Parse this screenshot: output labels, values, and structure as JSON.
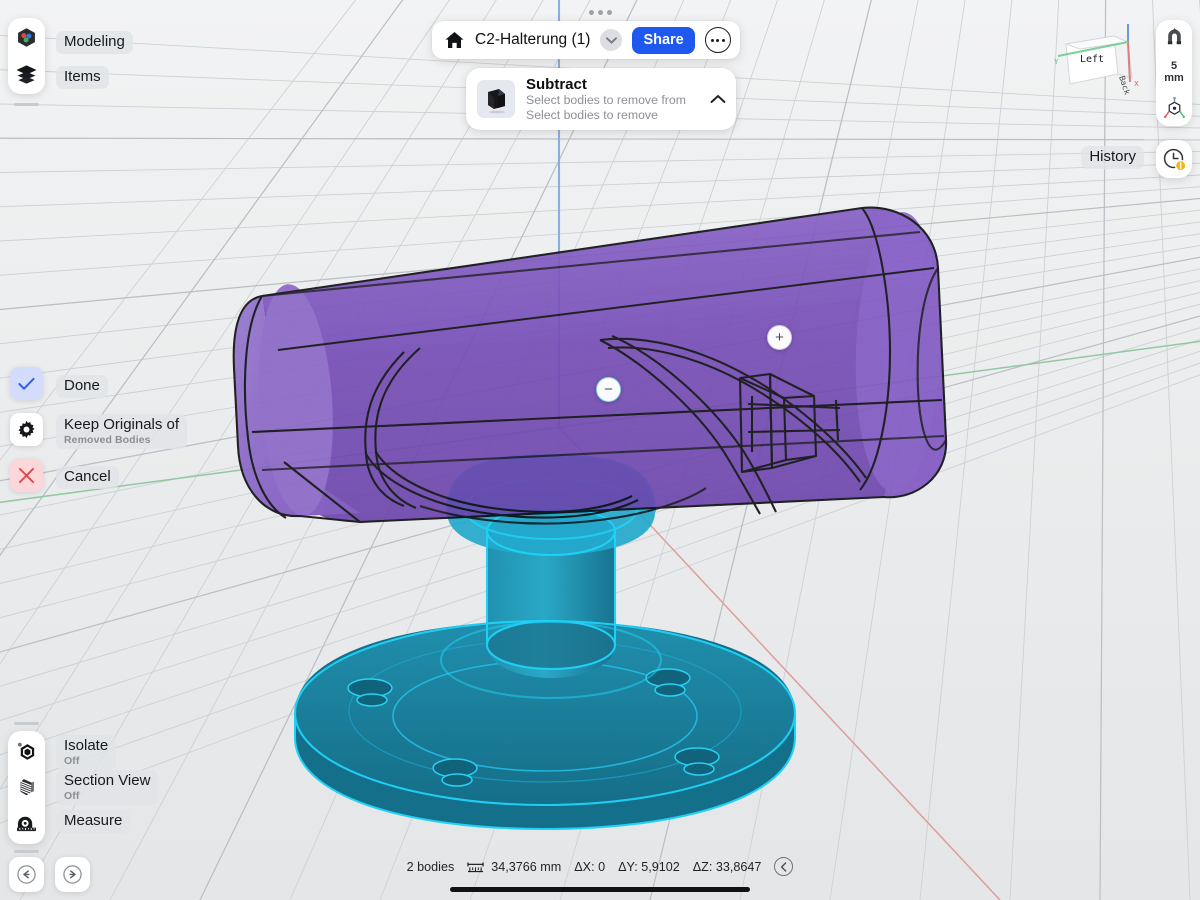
{
  "app": {
    "background_color": "#edeff1",
    "accent_blue": "#1f58ef"
  },
  "titlebar": {
    "home_icon": "home-icon",
    "document_name": "C2-Halterung (1)",
    "dropdown_icon": "chevron-down-icon",
    "share_label": "Share",
    "more_icon": "more-options-icon"
  },
  "multitask": {
    "icon": "multitask-dots-icon"
  },
  "operation_card": {
    "thumbnail_icon": "subtract-preview-icon",
    "title": "Subtract",
    "line1": "Select bodies to remove from",
    "line2": "Select bodies to remove",
    "collapse_icon": "chevron-up-icon"
  },
  "left_top_rail": {
    "items": [
      {
        "icon": "modeling-cube-icon",
        "label": "Modeling"
      },
      {
        "icon": "items-layers-icon",
        "label": "Items"
      }
    ]
  },
  "left_action_rail": {
    "items": [
      {
        "icon": "checkmark-icon",
        "label": "Done",
        "sublabel": "",
        "style": "blue"
      },
      {
        "icon": "gear-icon",
        "label": "Keep Originals of",
        "sublabel": "Removed Bodies",
        "style": "std"
      },
      {
        "icon": "cross-icon",
        "label": "Cancel",
        "sublabel": "",
        "style": "red"
      }
    ]
  },
  "left_bottom_rail": {
    "items": [
      {
        "icon": "isolate-icon",
        "label": "Isolate",
        "sublabel": "Off"
      },
      {
        "icon": "section-view-icon",
        "label": "Section View",
        "sublabel": "Off"
      },
      {
        "icon": "measure-tape-icon",
        "label": "Measure",
        "sublabel": ""
      }
    ]
  },
  "history_controls": {
    "undo_icon": "undo-icon",
    "redo_icon": "redo-icon"
  },
  "right_rail": {
    "snap_icon": "magnet-snap-icon",
    "snap_value": "5",
    "snap_unit": "mm",
    "orientation_icon": "axis-orientation-icon"
  },
  "history_panel": {
    "label": "History",
    "icon": "history-clock-icon",
    "badge_icon": "warning-badge-icon",
    "badge_color": "#f5b614"
  },
  "viewcube": {
    "face_label": "Left",
    "side_label": "Back",
    "axis_z_color": "#5b8fe0",
    "axis_y_color": "#4ec07a",
    "axis_x_color": "#e05b5b"
  },
  "manipulators": [
    {
      "name": "plus-handle",
      "symbol": "+"
    },
    {
      "name": "minus-handle",
      "symbol": "−"
    }
  ],
  "statusbar": {
    "bodies": "2 bodies",
    "measure_icon": "dimension-icon",
    "distance": "34,3766 mm",
    "delta_x": "ΔX: 0",
    "delta_y": "ΔY: 5,9102",
    "delta_z": "ΔZ: 33,8647",
    "collapse_icon": "chevron-left-icon"
  },
  "scene": {
    "purple_body_color": "#7a4fbb",
    "teal_body_color": "#15758f",
    "teal_edge_color": "#18c7f0",
    "grid_color": "#c9ccd0",
    "axis_x_color": "#d98a8a",
    "axis_y_color": "#8ec79d",
    "axis_z_color": "#85acdf"
  }
}
